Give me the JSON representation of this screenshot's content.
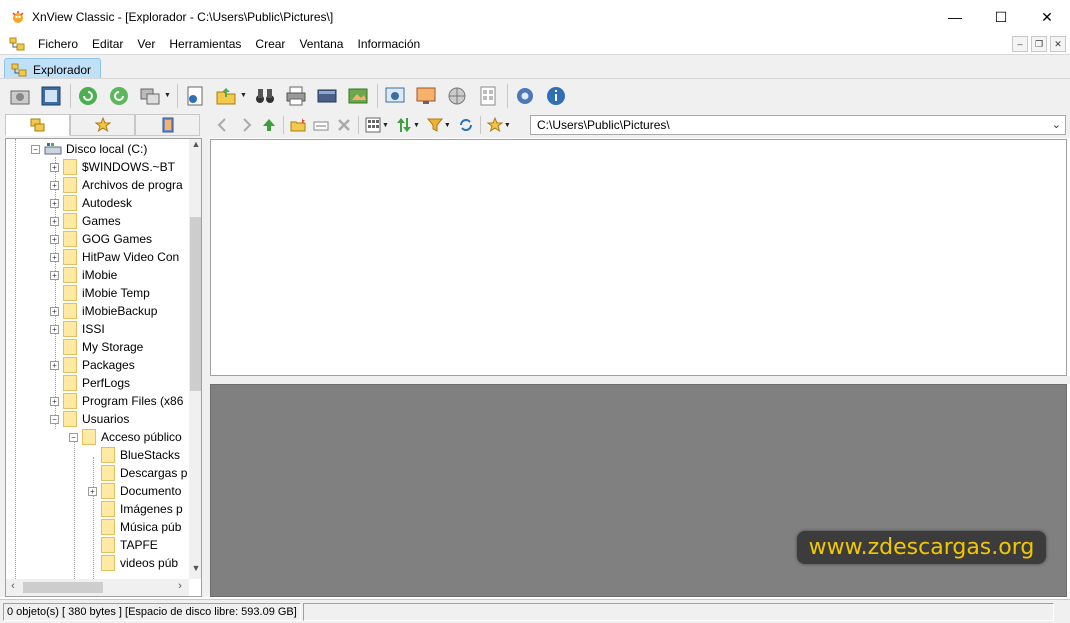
{
  "window": {
    "title": "XnView Classic - [Explorador - C:\\Users\\Public\\Pictures\\]",
    "minimize_glyph": "—",
    "maximize_glyph": "☐",
    "close_glyph": "✕"
  },
  "menu": {
    "items": [
      "Fichero",
      "Editar",
      "Ver",
      "Herramientas",
      "Crear",
      "Ventana",
      "Información"
    ],
    "mdi_minimize": "–",
    "mdi_restore": "❐",
    "mdi_close": "✕"
  },
  "tabs": [
    {
      "label": "Explorador"
    }
  ],
  "navbar": {
    "path": "C:\\Users\\Public\\Pictures\\"
  },
  "tree": {
    "root": "Disco local (C:)",
    "items": [
      {
        "label": "$WINDOWS.~BT",
        "expandable": true
      },
      {
        "label": "Archivos de progra",
        "expandable": true
      },
      {
        "label": "Autodesk",
        "expandable": true
      },
      {
        "label": "Games",
        "expandable": true
      },
      {
        "label": "GOG Games",
        "expandable": true
      },
      {
        "label": "HitPaw Video Con",
        "expandable": true
      },
      {
        "label": "iMobie",
        "expandable": true
      },
      {
        "label": "iMobie Temp",
        "expandable": false
      },
      {
        "label": "iMobieBackup",
        "expandable": true
      },
      {
        "label": "ISSI",
        "expandable": true
      },
      {
        "label": "My Storage",
        "expandable": false
      },
      {
        "label": "Packages",
        "expandable": true
      },
      {
        "label": "PerfLogs",
        "expandable": false
      },
      {
        "label": "Program Files (x86",
        "expandable": true
      },
      {
        "label": "Usuarios",
        "expandable": true,
        "expanded": true
      }
    ],
    "public_folder": "Acceso público",
    "public_children": [
      {
        "label": "BlueStacks",
        "expandable": false
      },
      {
        "label": "Descargas p",
        "expandable": false
      },
      {
        "label": "Documento",
        "expandable": true
      },
      {
        "label": "Imágenes p",
        "expandable": false
      },
      {
        "label": "Música púb",
        "expandable": false
      },
      {
        "label": "TAPFE",
        "expandable": false
      },
      {
        "label": "videos púb",
        "expandable": false
      }
    ]
  },
  "status": {
    "text": "0 objeto(s) [ 380 bytes ] [Espacio de disco libre: 593.09 GB]"
  },
  "watermark": "www.zdescargas.org",
  "colors": {
    "tab_active": "#bfe0f7",
    "preview_bg": "#808080",
    "watermark_text": "#f2c700"
  }
}
